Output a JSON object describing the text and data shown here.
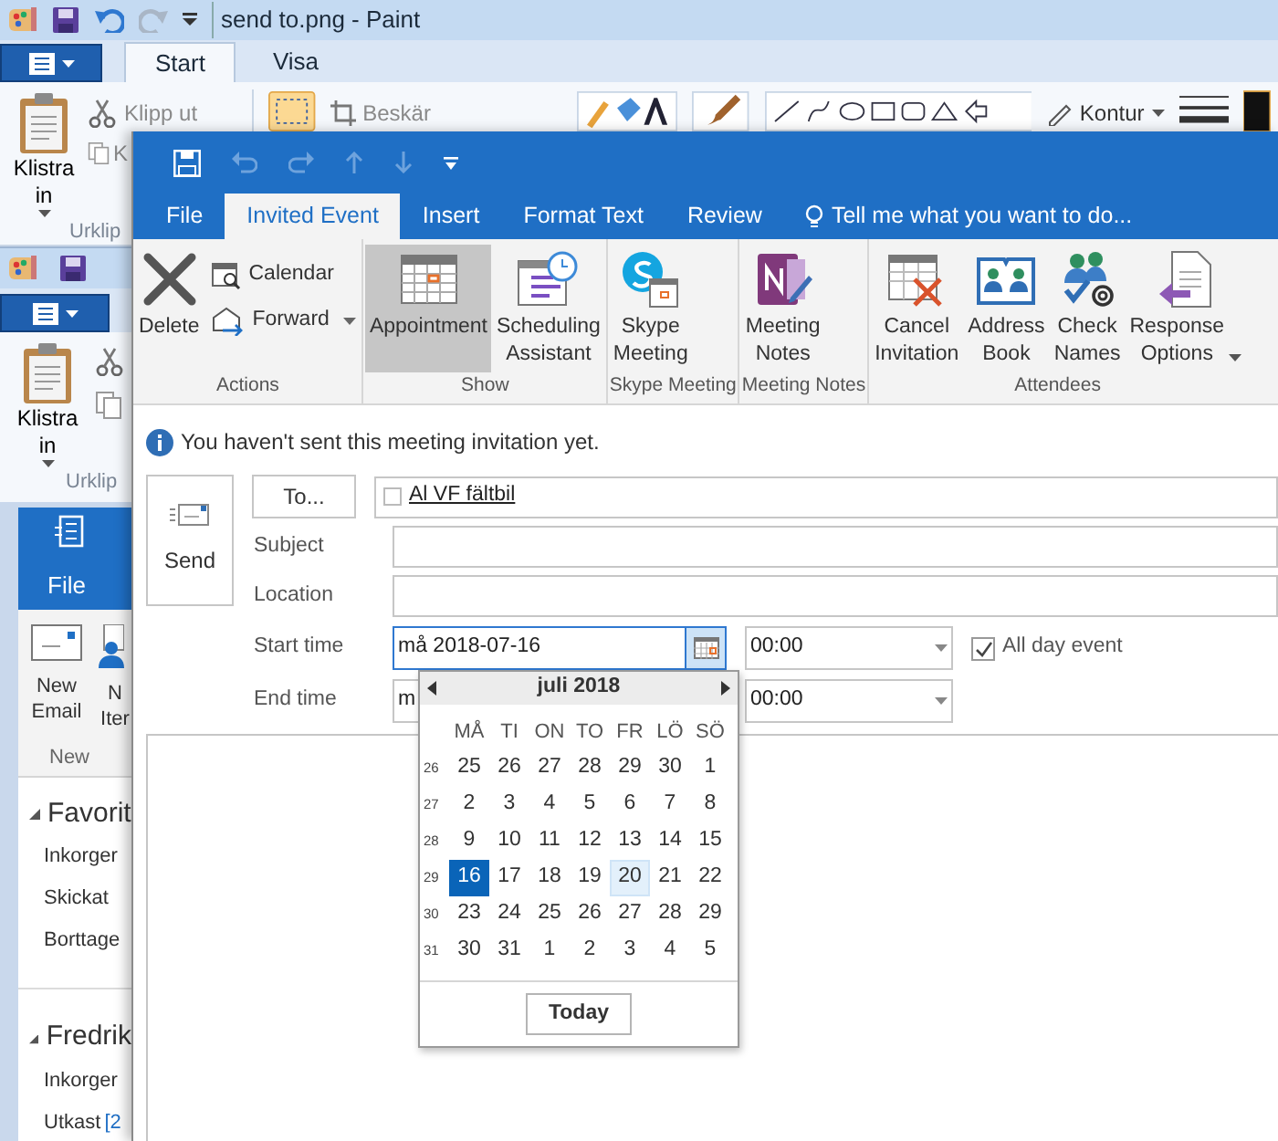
{
  "paint_window": {
    "title": "send to.png - Paint",
    "tabs": [
      {
        "label": "Start",
        "selected": true
      },
      {
        "label": "Visa",
        "selected": false
      }
    ],
    "paste": "Klistra in",
    "cut": "Klipp ut",
    "copy": "K",
    "clipboard_group": "Urklip",
    "crop": "Beskär",
    "outline": "Kontur"
  },
  "paint_window_2": {
    "paste": "Klistra in",
    "clipboard_group": "Urklip"
  },
  "outlook_window": {
    "tab": "File",
    "buttons": [
      {
        "label": "New Email"
      },
      {
        "label": "N Iter"
      }
    ],
    "group": "New",
    "folders": [
      {
        "label": "Favorit",
        "expanded": true,
        "children": [
          {
            "label": "Inkorger"
          },
          {
            "label": "Skickat"
          },
          {
            "label": "Borttage"
          }
        ]
      },
      {
        "label": "Fredrik",
        "expanded": true,
        "children": [
          {
            "label": "Inkorger"
          },
          {
            "label": "Utkast",
            "count": "[2"
          }
        ]
      }
    ]
  },
  "meeting_window": {
    "tabs": [
      {
        "label": "File",
        "selected": false
      },
      {
        "label": "Invited Event",
        "selected": true
      },
      {
        "label": "Insert",
        "selected": false
      },
      {
        "label": "Format Text",
        "selected": false
      },
      {
        "label": "Review",
        "selected": false
      }
    ],
    "tell_me": "Tell me what you want to do...",
    "ribbon": {
      "groups": [
        {
          "label": "Actions",
          "buttons": [
            {
              "label": "Delete",
              "kind": "large",
              "selected": false,
              "dropdown": false
            },
            {
              "label": "Calendar",
              "kind": "small",
              "selected": false,
              "dropdown": false
            },
            {
              "label": "Forward",
              "kind": "small",
              "selected": false,
              "dropdown": true
            }
          ]
        },
        {
          "label": "Show",
          "buttons": [
            {
              "label": "Appointment",
              "kind": "large",
              "selected": true,
              "dropdown": false
            },
            {
              "label": "Scheduling Assistant",
              "kind": "large",
              "selected": false,
              "dropdown": false
            }
          ]
        },
        {
          "label": "Skype Meeting",
          "buttons": [
            {
              "label": "Skype Meeting",
              "kind": "large",
              "selected": false,
              "dropdown": false
            }
          ]
        },
        {
          "label": "Meeting Notes",
          "buttons": [
            {
              "label": "Meeting Notes",
              "kind": "large",
              "selected": false,
              "dropdown": false
            }
          ]
        },
        {
          "label": "Attendees",
          "buttons": [
            {
              "label": "Cancel Invitation",
              "kind": "large",
              "selected": false,
              "dropdown": false
            },
            {
              "label": "Address Book",
              "kind": "large",
              "selected": false,
              "dropdown": false
            },
            {
              "label": "Check Names",
              "kind": "large",
              "selected": false,
              "dropdown": false
            },
            {
              "label": "Response Options",
              "kind": "large",
              "selected": false,
              "dropdown": true
            }
          ]
        }
      ]
    },
    "info": "You haven't sent this meeting invitation yet.",
    "send": "Send",
    "to_button": "To...",
    "recipients": [
      {
        "name": "Al VF fältbil",
        "checked": false
      }
    ],
    "fields": [
      {
        "label": "Subject"
      },
      {
        "label": "Location"
      }
    ],
    "start": {
      "label": "Start time",
      "date": "må 2018-07-16",
      "time": "00:00"
    },
    "all_day": {
      "label": "All day event",
      "checked": true
    },
    "end": {
      "label": "End time",
      "date": "m",
      "time": "00:00"
    },
    "date_picker": {
      "month": "juli 2018",
      "weekdays": [
        "MÅ",
        "TI",
        "ON",
        "TO",
        "FR",
        "LÖ",
        "SÖ"
      ],
      "weeks": [
        {
          "number": "26",
          "days": [
            {
              "day": "25",
              "selected": false,
              "highlighted": false
            },
            {
              "day": "26",
              "selected": false,
              "highlighted": false
            },
            {
              "day": "27",
              "selected": false,
              "highlighted": false
            },
            {
              "day": "28",
              "selected": false,
              "highlighted": false
            },
            {
              "day": "29",
              "selected": false,
              "highlighted": false
            },
            {
              "day": "30",
              "selected": false,
              "highlighted": false
            },
            {
              "day": "1",
              "selected": false,
              "highlighted": false
            }
          ]
        },
        {
          "number": "27",
          "days": [
            {
              "day": "2",
              "selected": false,
              "highlighted": false
            },
            {
              "day": "3",
              "selected": false,
              "highlighted": false
            },
            {
              "day": "4",
              "selected": false,
              "highlighted": false
            },
            {
              "day": "5",
              "selected": false,
              "highlighted": false
            },
            {
              "day": "6",
              "selected": false,
              "highlighted": false
            },
            {
              "day": "7",
              "selected": false,
              "highlighted": false
            },
            {
              "day": "8",
              "selected": false,
              "highlighted": false
            }
          ]
        },
        {
          "number": "28",
          "days": [
            {
              "day": "9",
              "selected": false,
              "highlighted": false
            },
            {
              "day": "10",
              "selected": false,
              "highlighted": false
            },
            {
              "day": "11",
              "selected": false,
              "highlighted": false
            },
            {
              "day": "12",
              "selected": false,
              "highlighted": false
            },
            {
              "day": "13",
              "selected": false,
              "highlighted": false
            },
            {
              "day": "14",
              "selected": false,
              "highlighted": false
            },
            {
              "day": "15",
              "selected": false,
              "highlighted": false
            }
          ]
        },
        {
          "number": "29",
          "days": [
            {
              "day": "16",
              "selected": true,
              "highlighted": false
            },
            {
              "day": "17",
              "selected": false,
              "highlighted": false
            },
            {
              "day": "18",
              "selected": false,
              "highlighted": false
            },
            {
              "day": "19",
              "selected": false,
              "highlighted": false
            },
            {
              "day": "20",
              "selected": false,
              "highlighted": true
            },
            {
              "day": "21",
              "selected": false,
              "highlighted": false
            },
            {
              "day": "22",
              "selected": false,
              "highlighted": false
            }
          ]
        },
        {
          "number": "30",
          "days": [
            {
              "day": "23",
              "selected": false,
              "highlighted": false
            },
            {
              "day": "24",
              "selected": false,
              "highlighted": false
            },
            {
              "day": "25",
              "selected": false,
              "highlighted": false
            },
            {
              "day": "26",
              "selected": false,
              "highlighted": false
            },
            {
              "day": "27",
              "selected": false,
              "highlighted": false
            },
            {
              "day": "28",
              "selected": false,
              "highlighted": false
            },
            {
              "day": "29",
              "selected": false,
              "highlighted": false
            }
          ]
        },
        {
          "number": "31",
          "days": [
            {
              "day": "30",
              "selected": false,
              "highlighted": false
            },
            {
              "day": "31",
              "selected": false,
              "highlighted": false
            },
            {
              "day": "1",
              "selected": false,
              "highlighted": false
            },
            {
              "day": "2",
              "selected": false,
              "highlighted": false
            },
            {
              "day": "3",
              "selected": false,
              "highlighted": false
            },
            {
              "day": "4",
              "selected": false,
              "highlighted": false
            },
            {
              "day": "5",
              "selected": false,
              "highlighted": false
            }
          ]
        }
      ],
      "today": "Today"
    }
  }
}
